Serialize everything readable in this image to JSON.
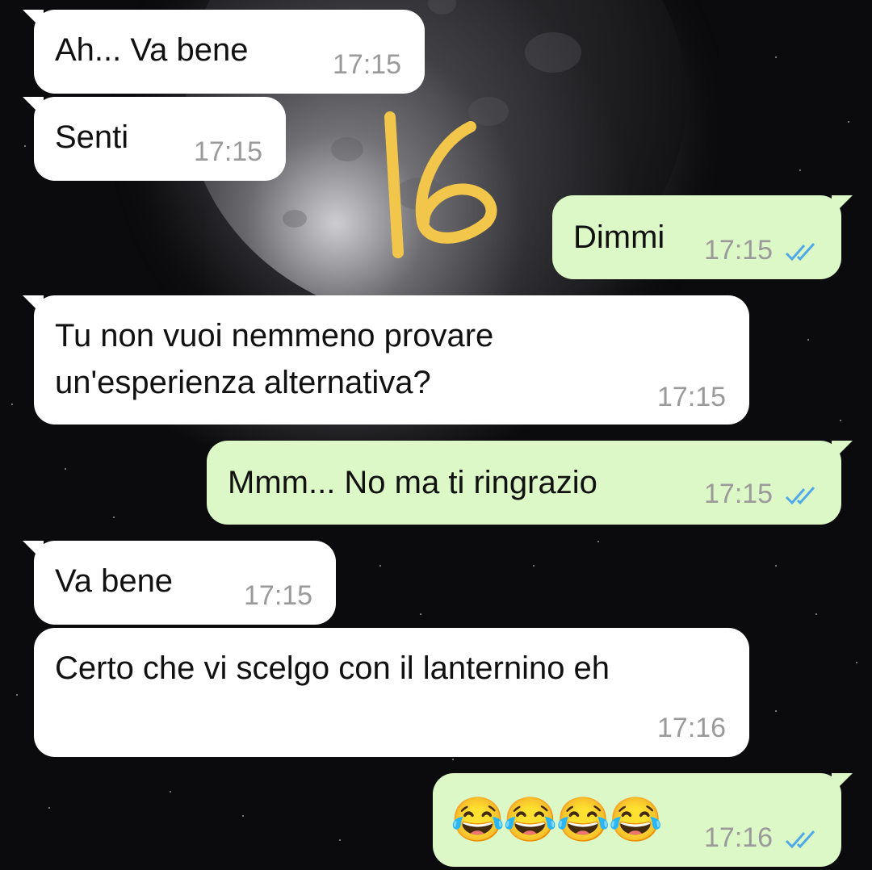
{
  "sticker_text": "16",
  "messages": [
    {
      "direction": "incoming",
      "text": "Ah... Va bene",
      "time": "17:15"
    },
    {
      "direction": "incoming",
      "text": "Senti",
      "time": "17:15"
    },
    {
      "direction": "outgoing",
      "text": "Dimmi",
      "time": "17:15",
      "status": "read"
    },
    {
      "direction": "incoming",
      "text_lines": [
        "Tu non vuoi nemmeno provare",
        "un'esperienza alternativa?"
      ],
      "time": "17:15"
    },
    {
      "direction": "outgoing",
      "text": "Mmm... No ma ti ringrazio",
      "time": "17:15",
      "status": "read"
    },
    {
      "direction": "incoming",
      "text": "Va bene",
      "time": "17:15"
    },
    {
      "direction": "incoming",
      "text": "Certo che vi scelgo con il lanternino eh",
      "time": "17:16"
    },
    {
      "direction": "outgoing",
      "emoji": "😂😂😂😂",
      "time": "17:16",
      "status": "read"
    }
  ],
  "colors": {
    "incoming_bubble": "#ffffff",
    "outgoing_bubble": "#dcf8c6",
    "timestamp": "#9a9a9a",
    "read_ticks": "#4fa9e8",
    "sticker": "#f2c64a"
  },
  "icons": {
    "read_receipt": "double-check-icon",
    "laugh": "face-with-tears-of-joy"
  }
}
